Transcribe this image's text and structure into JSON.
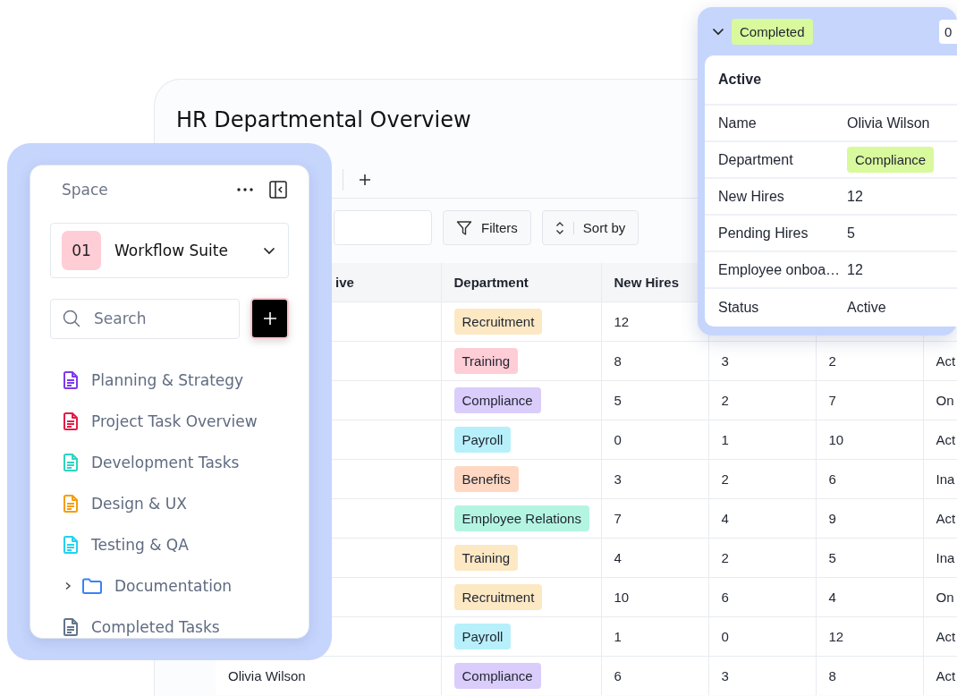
{
  "main": {
    "title": "HR Departmental Overview",
    "toolbar": {
      "buttons": [
        {
          "kind": "filter",
          "label": "Filters"
        },
        {
          "kind": "sort",
          "label": "Sort by"
        }
      ]
    },
    "table": {
      "columns": [
        "ive",
        "Department",
        "New Hires"
      ],
      "rows": [
        {
          "department": {
            "label": "Recruitment",
            "color": "#fde8c4"
          },
          "new_hires": "12"
        },
        {
          "department": {
            "label": "Training",
            "color": "#fecdd6"
          },
          "new_hires": "8",
          "column_4": "3",
          "column_5": "2",
          "column_6": "Act"
        },
        {
          "department": {
            "label": "Compliance",
            "color": "#dacdfb"
          },
          "new_hires": "5",
          "column_4": "2",
          "column_5": "7",
          "column_6": "On"
        },
        {
          "department": {
            "label": "Payroll",
            "color": "#b7f0fb"
          },
          "new_hires": "0",
          "column_4": "1",
          "column_5": "10",
          "column_6": "Act"
        },
        {
          "department": {
            "label": "Benefits",
            "color": "#fed8c3"
          },
          "new_hires": "3",
          "column_4": "2",
          "column_5": "6",
          "column_6": "Ina"
        },
        {
          "department": {
            "label": "Employee Relations",
            "color": "#b4f5e2"
          },
          "new_hires": "7",
          "column_4": "4",
          "column_5": "9",
          "column_6": "Act"
        },
        {
          "department": {
            "label": "Training",
            "color": "#fde8c4"
          },
          "new_hires": "4",
          "column_4": "2",
          "column_5": "5",
          "column_6": "Ina"
        },
        {
          "department": {
            "label": "Recruitment",
            "color": "#fde8c4"
          },
          "new_hires": "10",
          "column_4": "6",
          "column_5": "4",
          "column_6": "On"
        },
        {
          "department": {
            "label": "Payroll",
            "color": "#b7f0fb"
          },
          "new_hires": "1",
          "column_4": "0",
          "column_5": "12",
          "column_6": "Act"
        },
        {
          "name": "Olivia Wilson",
          "department": {
            "label": "Compliance",
            "color": "#dacdfb"
          },
          "new_hires": "6",
          "column_4": "3",
          "column_5": "8",
          "column_6": "Act"
        }
      ]
    }
  },
  "sidebar": {
    "header": "Space",
    "workspace": {
      "badge": "01",
      "name": "Workflow Suite"
    },
    "search": {
      "placeholder": "Search"
    },
    "items": [
      {
        "kind": "doc",
        "label": "Planning & Strategy",
        "color": "#7c3aed"
      },
      {
        "kind": "doc",
        "label": "Project Task Overview",
        "color": "#e11d48"
      },
      {
        "kind": "doc",
        "label": "Development Tasks",
        "color": "#2dd4bf"
      },
      {
        "kind": "doc",
        "label": "Design & UX",
        "color": "#f59e0b"
      },
      {
        "kind": "doc",
        "label": "Testing & QA",
        "color": "#22d3ee"
      },
      {
        "kind": "folder",
        "label": "Documentation",
        "color": "#3b82f6",
        "expanded": false
      },
      {
        "kind": "doc",
        "label": "Completed Tasks",
        "color": "#64748b"
      }
    ]
  },
  "record": {
    "expanded": true,
    "status": {
      "label": "Completed",
      "color": "#d9f99d"
    },
    "counter": "0",
    "heading": "Active",
    "fields": [
      {
        "label": "Name",
        "value": "Olivia Wilson"
      },
      {
        "label": "Department",
        "value": "Compliance",
        "kind": "tag",
        "color": "#d9f99d"
      },
      {
        "label": "New Hires",
        "value": "12"
      },
      {
        "label": "Pending Hires",
        "value": "5"
      },
      {
        "label": "Employee onboa…",
        "value": "12"
      },
      {
        "label": "Status",
        "value": "Active"
      }
    ]
  }
}
